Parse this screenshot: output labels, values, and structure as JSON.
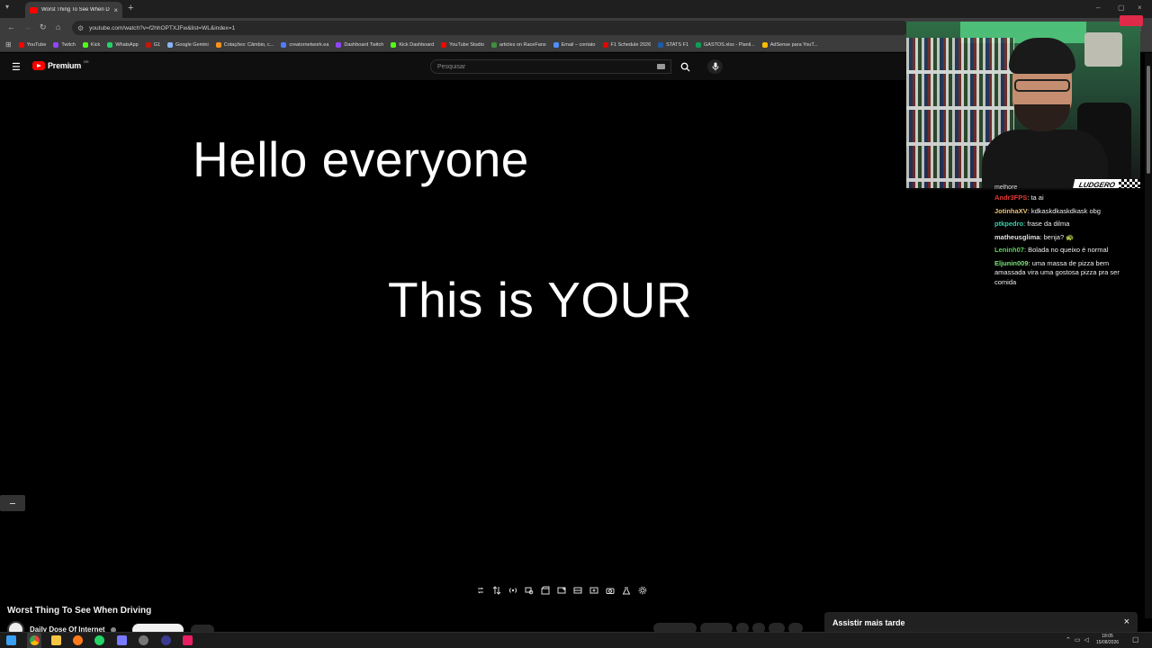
{
  "browser": {
    "tab_title": "Worst Thing To See When Driving",
    "url": "youtube.com/watch?v=f2hhOPTXJFw&list=WL&index=1",
    "bookmarks": [
      {
        "label": "YouTube",
        "color": "#ff0000"
      },
      {
        "label": "Twitch",
        "color": "#9146ff"
      },
      {
        "label": "Kick",
        "color": "#53fc18"
      },
      {
        "label": "WhatsApp",
        "color": "#25d366"
      },
      {
        "label": "G1",
        "color": "#c4170c"
      },
      {
        "label": "Google Gemini",
        "color": "#8ab4f8"
      },
      {
        "label": "Cotações: Câmbio, c...",
        "color": "#f7931a"
      },
      {
        "label": "creatornetwork.ea",
        "color": "#4f7cff"
      },
      {
        "label": "Dashboard Twitch",
        "color": "#9146ff"
      },
      {
        "label": "Kick Dashboard",
        "color": "#53fc18"
      },
      {
        "label": "YouTube Studio",
        "color": "#ff0000"
      },
      {
        "label": "articles on RaceFans",
        "color": "#3f8f3f"
      },
      {
        "label": "Email – contato",
        "color": "#4d90fe"
      },
      {
        "label": "F1 Schedule 2026",
        "color": "#e10600"
      },
      {
        "label": "STATS F1",
        "color": "#1e5aa8"
      },
      {
        "label": "GASTOS.xlsx - Planil...",
        "color": "#0f9d58"
      },
      {
        "label": "AdSense para YouT...",
        "color": "#fbbc04"
      }
    ]
  },
  "youtube": {
    "brand": "Premium",
    "brand_sup": "BR",
    "search_placeholder": "Pesquisar",
    "accent": "#ff0000"
  },
  "video": {
    "caption_line1": "Hello everyone",
    "caption_line2": "This is YOUR",
    "title": "Worst Thing To See When Driving",
    "channel": "Daily Dose Of Internet"
  },
  "toast": {
    "text": "Assistir mais tarde"
  },
  "overlay": {
    "cam_logo": "LUDGERO"
  },
  "chat": {
    "partial_top": "melhore",
    "messages": [
      {
        "user": "Andr3FPS",
        "color": "#e53935",
        "text": "ta ai"
      },
      {
        "user": "JotinhaXV",
        "color": "#e8c27a",
        "text": "kdkaskdkaskdkask obg"
      },
      {
        "user": "ptkpedro",
        "color": "#39d0a8",
        "text": "frase da dilma"
      },
      {
        "user": "matheusglima",
        "color": "#e0e0e0",
        "text": "benja? 🐢"
      },
      {
        "user": "Leninh07",
        "color": "#5fd35f",
        "text": "Bolada no queixo é normal"
      },
      {
        "user": "Eljunin009",
        "color": "#7de37d",
        "text": "uma massa de pizza bem amassada vira uma gostosa pizza pra ser comida"
      }
    ]
  },
  "taskbar": {
    "time": "18:05",
    "date": "15/08/2026"
  }
}
